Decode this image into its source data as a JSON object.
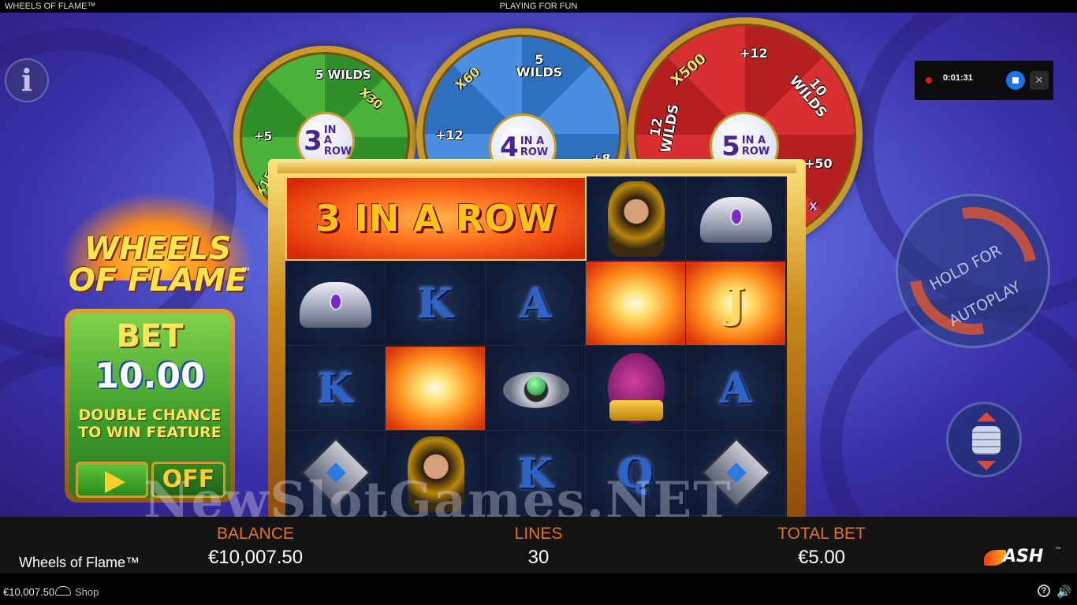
{
  "topbar": {
    "game_title": "WHEELS OF FLAME™",
    "mode": "PLAYING FOR FUN"
  },
  "wheels": [
    {
      "color": "#3a9a2e",
      "hub_number": "3",
      "hub_text": "IN A ROW",
      "segments": [
        "5 WILDS",
        "X30",
        "+5",
        "X15"
      ]
    },
    {
      "color": "#3a7ad0",
      "hub_number": "4",
      "hub_text": "IN A ROW",
      "segments": [
        "X60",
        "5 WILDS",
        "+12",
        "+8"
      ]
    },
    {
      "color": "#c82828",
      "hub_number": "5",
      "hub_text": "IN A ROW",
      "segments": [
        "X500",
        "+12",
        "10 WILDS",
        "12 WILDS",
        "+50",
        "X"
      ]
    }
  ],
  "logo": {
    "text": "WHEELS OF FLAME",
    "tm": "™"
  },
  "bet_panel": {
    "title": "BET",
    "value": "10.00",
    "description": "DOUBLE CHANCE TO WIN FEATURE",
    "toggle_label": "OFF",
    "play_icon": "play-icon"
  },
  "reels": {
    "banner": "3 IN A ROW",
    "cells": [
      {
        "row": 0,
        "col": 3,
        "symbol": "queen",
        "icon": "queen-icon"
      },
      {
        "row": 0,
        "col": 4,
        "symbol": "crown",
        "icon": "crown-icon"
      },
      {
        "row": 1,
        "col": 0,
        "symbol": "crown",
        "icon": "crown-icon"
      },
      {
        "row": 1,
        "col": 1,
        "symbol": "K"
      },
      {
        "row": 1,
        "col": 2,
        "symbol": "A"
      },
      {
        "row": 1,
        "col": 3,
        "symbol": "fire",
        "icon": "fire-icon"
      },
      {
        "row": 1,
        "col": 4,
        "symbol": "J",
        "on_fire": true
      },
      {
        "row": 2,
        "col": 0,
        "symbol": "K"
      },
      {
        "row": 2,
        "col": 1,
        "symbol": "fire",
        "icon": "fire-icon"
      },
      {
        "row": 2,
        "col": 2,
        "symbol": "ring",
        "icon": "ring-icon"
      },
      {
        "row": 2,
        "col": 3,
        "symbol": "egg",
        "icon": "dragon-egg-icon"
      },
      {
        "row": 2,
        "col": 4,
        "symbol": "A"
      },
      {
        "row": 3,
        "col": 0,
        "symbol": "lantern",
        "icon": "lantern-icon"
      },
      {
        "row": 3,
        "col": 1,
        "symbol": "queen",
        "icon": "queen-icon"
      },
      {
        "row": 3,
        "col": 2,
        "symbol": "K"
      },
      {
        "row": 3,
        "col": 3,
        "symbol": "Q"
      },
      {
        "row": 3,
        "col": 4,
        "symbol": "lantern",
        "icon": "lantern-icon"
      }
    ]
  },
  "autoplay": {
    "label": "HOLD FOR AUTOPLAY",
    "icon": "spin-icon"
  },
  "stake_button": {
    "icon": "coin-stack-icon"
  },
  "recorder": {
    "time": "0:01:31",
    "stop_icon": "stop-icon",
    "mic_icon": "mic-off-icon"
  },
  "watermark": "NewSlotGames.NET",
  "info_bar": {
    "game_name": "Wheels of Flame™",
    "balance_label": "BALANCE",
    "balance_value": "€10,007.50",
    "lines_label": "LINES",
    "lines_value": "30",
    "total_bet_label": "TOTAL BET",
    "total_bet_value": "€5.00",
    "brand": "ASH",
    "brand_tm": "™"
  },
  "status_bar": {
    "balance": "€10,007.50",
    "shop_label": "Shop",
    "help_icon": "help-icon",
    "sound_icon": "sound-icon"
  },
  "colors": {
    "accent_orange": "#e8701e",
    "bet_green": "#3b9a2a",
    "frame_gold": "#c98a1a"
  }
}
